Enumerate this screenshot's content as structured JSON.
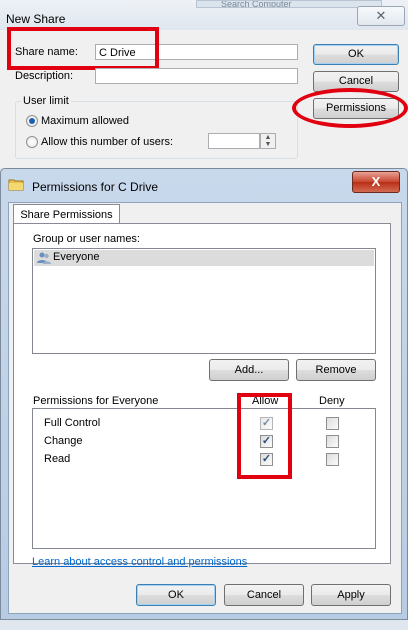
{
  "new_share": {
    "title": "New Share",
    "search_placeholder": "Search Computer",
    "close_glyph": "✕",
    "share_name_label": "Share name:",
    "share_name_value": "C Drive",
    "description_label": "Description:",
    "description_value": "",
    "user_limit_label": "User limit",
    "maximum_allowed_label": "Maximum allowed",
    "maximum_allowed_selected": true,
    "allow_number_label": "Allow this number of users:",
    "allow_number_value": "",
    "ok_label": "OK",
    "cancel_label": "Cancel",
    "permissions_label": "Permissions"
  },
  "permissions_dialog": {
    "title": "Permissions for C Drive",
    "close_glyph": "X",
    "tab_label": "Share Permissions",
    "group_label": "Group or user names:",
    "users": [
      "Everyone"
    ],
    "add_label": "Add...",
    "remove_label": "Remove",
    "permissions_for_label": "Permissions for Everyone",
    "allow_header": "Allow",
    "deny_header": "Deny",
    "permissions": [
      {
        "name": "Full Control",
        "allow": true,
        "deny": false
      },
      {
        "name": "Change",
        "allow": true,
        "deny": false
      },
      {
        "name": "Read",
        "allow": true,
        "deny": false
      }
    ],
    "learn_link": "Learn about access control and permissions",
    "ok_label": "OK",
    "cancel_label": "Cancel",
    "apply_label": "Apply"
  },
  "colors": {
    "annotation_red": "#e00010",
    "link": "#0066cc",
    "selection_blue": "#1b5fb3"
  }
}
